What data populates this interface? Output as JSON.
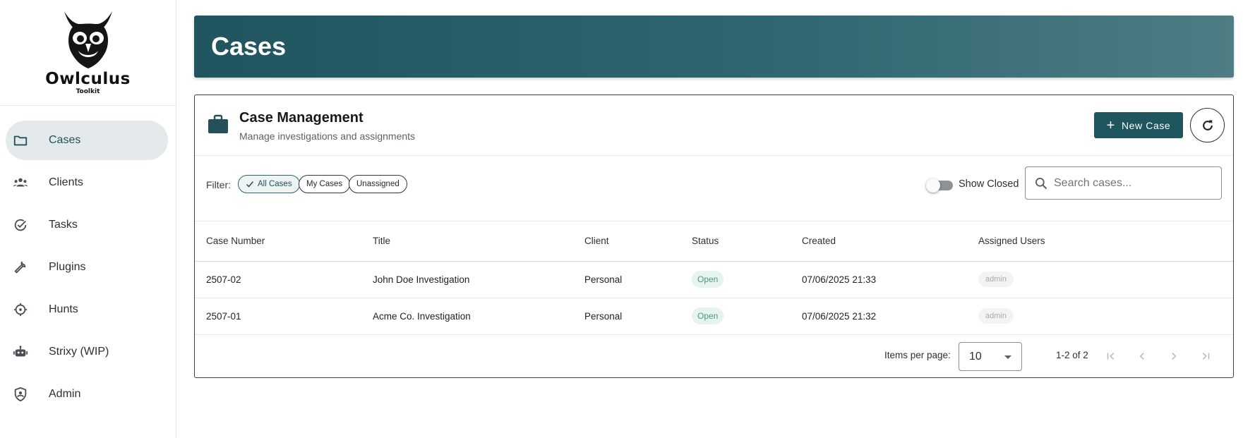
{
  "brand": {
    "title": "Owlculus",
    "subtitle": "Toolkit"
  },
  "sidebar": {
    "items": [
      {
        "label": "Cases",
        "icon": "folder-icon",
        "active": true
      },
      {
        "label": "Clients",
        "icon": "group-icon"
      },
      {
        "label": "Tasks",
        "icon": "check-circle-icon"
      },
      {
        "label": "Plugins",
        "icon": "wrench-icon"
      },
      {
        "label": "Hunts",
        "icon": "crosshair-icon"
      },
      {
        "label": "Strixy (WIP)",
        "icon": "robot-icon"
      },
      {
        "label": "Admin",
        "icon": "shield-user-icon"
      }
    ]
  },
  "header": {
    "title": "Cases"
  },
  "card": {
    "title": "Case Management",
    "subtitle": "Manage investigations and assignments",
    "new_case_label": "New Case",
    "filter": {
      "label": "Filter:",
      "chips": [
        "All Cases",
        "My Cases",
        "Unassigned"
      ],
      "selected": "All Cases"
    },
    "show_closed_label": "Show Closed",
    "show_closed": false,
    "search_placeholder": "Search cases..."
  },
  "table": {
    "columns": [
      "Case Number",
      "Title",
      "Client",
      "Status",
      "Created",
      "Assigned Users"
    ],
    "rows": [
      {
        "case_number": "2507-02",
        "title": "John Doe Investigation",
        "client": "Personal",
        "status": "Open",
        "created": "07/06/2025 21:33",
        "assigned": "admin"
      },
      {
        "case_number": "2507-01",
        "title": "Acme Co. Investigation",
        "client": "Personal",
        "status": "Open",
        "created": "07/06/2025 21:32",
        "assigned": "admin"
      }
    ]
  },
  "pagination": {
    "items_per_page_label": "Items per page:",
    "items_per_page": "10",
    "range": "1-2 of 2"
  },
  "colors": {
    "primary": "#1f555e",
    "status_open": "#4a9a78"
  }
}
